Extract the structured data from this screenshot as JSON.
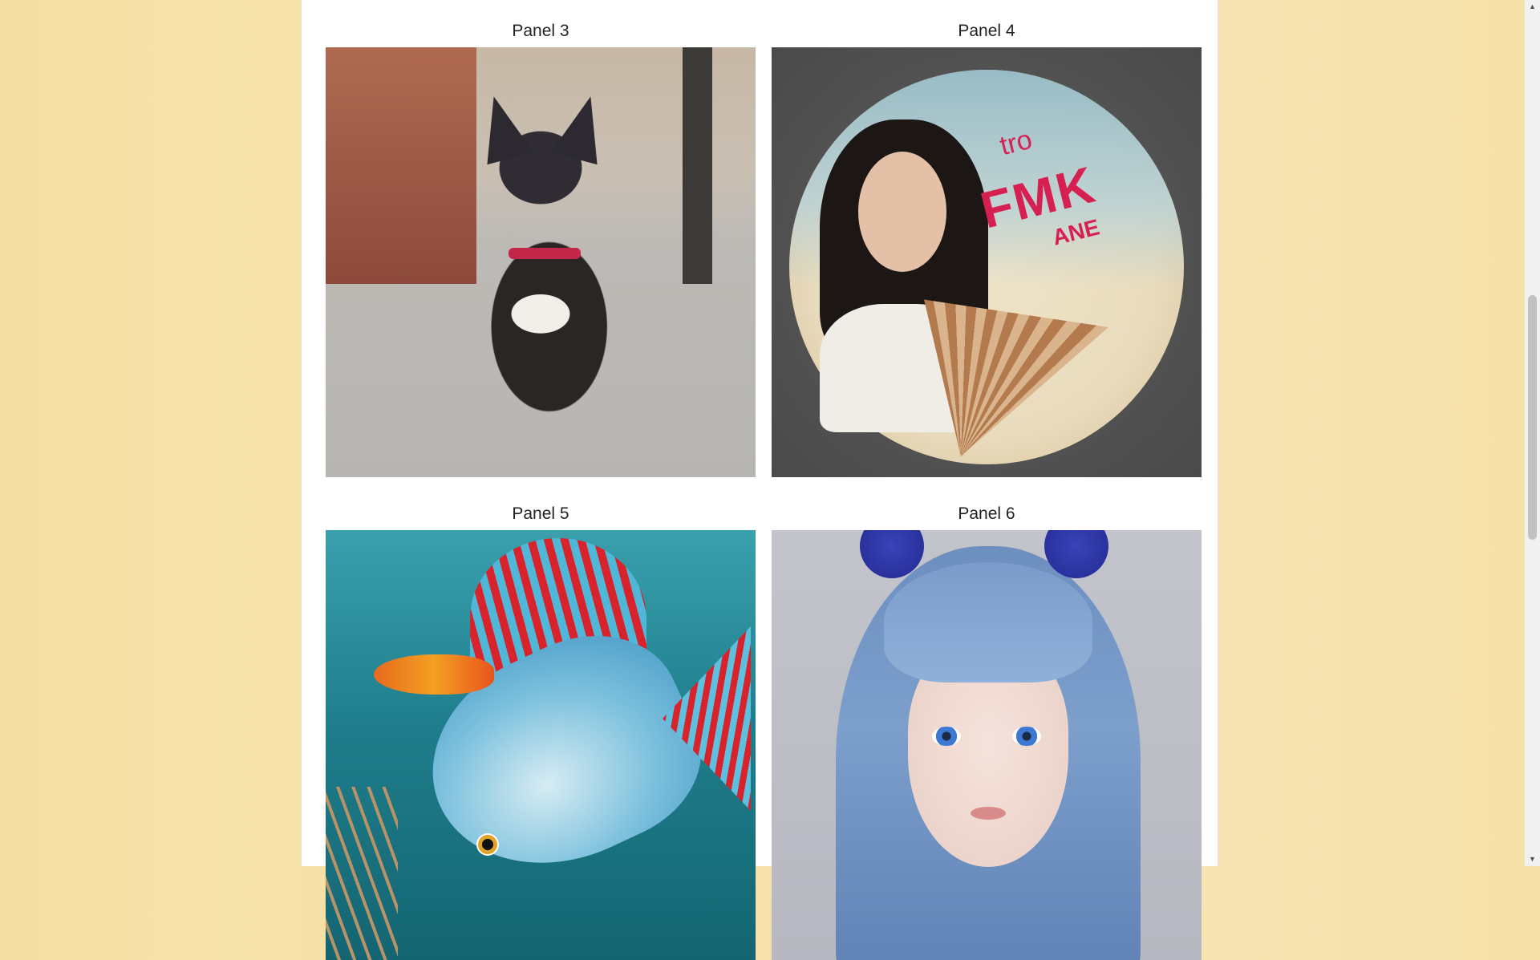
{
  "panels": [
    {
      "title": "Panel 3",
      "image": "dog-sitting-on-street"
    },
    {
      "title": "Panel 4",
      "image": "round-plaque-girl-with-fan",
      "plaque_text": [
        "tro",
        "FMK",
        "ANE"
      ]
    },
    {
      "title": "Panel 5",
      "image": "blue-fish-underwater"
    },
    {
      "title": "Panel 6",
      "image": "blue-haired-girl-portrait"
    }
  ],
  "scrollbar": {
    "up_icon": "triangle-up-icon",
    "down_icon": "triangle-down-icon",
    "position": 0.34
  }
}
